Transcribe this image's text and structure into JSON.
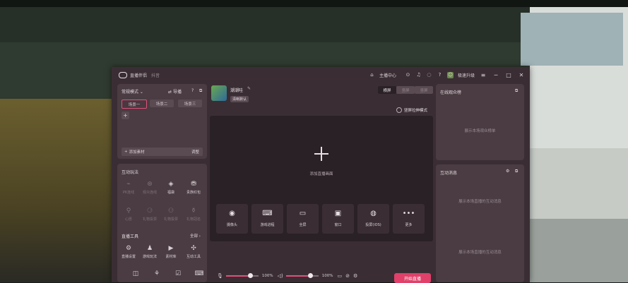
{
  "window": {
    "title": "直播伴侣",
    "subtitle": "抖音"
  },
  "titlebar": {
    "host_center": "主播中心",
    "upgrade": "极速升级",
    "min": "─",
    "max": "□",
    "close": "✕"
  },
  "scenes": {
    "mode_label": "常规模式",
    "guide_label": "导播",
    "items": [
      {
        "label": "场景一",
        "active": true
      },
      {
        "label": "场景二",
        "active": false
      },
      {
        "label": "场景三",
        "active": false
      }
    ],
    "add_icon": "+",
    "add_material": "添加素材",
    "adjust": "调整"
  },
  "interactive": {
    "title": "互动玩法",
    "items": [
      {
        "icon": "⌁",
        "label": "PK连线",
        "dim": true
      },
      {
        "icon": "⊛",
        "label": "观众连线",
        "dim": true
      },
      {
        "icon": "◈",
        "label": "福袋",
        "dim": false
      },
      {
        "icon": "⛃",
        "label": "贵族红包",
        "dim": false
      },
      {
        "icon": "⚲",
        "label": "心愿",
        "dim": true
      },
      {
        "icon": "⚆",
        "label": "礼物投票",
        "dim": true
      },
      {
        "icon": "⚇",
        "label": "礼物投票",
        "dim": true
      },
      {
        "icon": "⚱",
        "label": "礼物冠名",
        "dim": true
      }
    ]
  },
  "tools": {
    "title": "直播工具",
    "all": "全部 ›",
    "items": [
      {
        "icon": "⚙",
        "label": "直播设置"
      },
      {
        "icon": "♟",
        "label": "游戏玩法"
      },
      {
        "icon": "▶",
        "label": "素材库"
      },
      {
        "icon": "✣",
        "label": "互动工具"
      }
    ]
  },
  "stream": {
    "name": "潮潮哇",
    "tag": "清晰默认",
    "orientation": {
      "landscape": "横屏",
      "portrait": "竖屏",
      "both": "竖屏"
    },
    "stretch_mode": "竖屏拉伸模式",
    "add_scene_text": "添加直播画面",
    "sources": [
      {
        "icon": "◉",
        "label": "摄像头"
      },
      {
        "icon": "⌨",
        "label": "游戏进程"
      },
      {
        "icon": "▭",
        "label": "全屏"
      },
      {
        "icon": "▣",
        "label": "窗口"
      },
      {
        "icon": "",
        "label": "投屏(iOS)"
      },
      {
        "icon": "•••",
        "label": "更多"
      }
    ]
  },
  "audio": {
    "mic_percent": "100%",
    "speaker_percent": "100%",
    "mic_level": 0.75,
    "speaker_level": 0.75
  },
  "start_button": "开始直播",
  "viewers": {
    "title": "在线观众榜",
    "empty_hint": "展示本场观众榜单"
  },
  "messages": {
    "title": "互动消息",
    "hint_top": "展示本场直播的互动消息",
    "hint_bottom": "展示本场直播的互动消息"
  },
  "colors": {
    "accent": "#e0507a",
    "panel": "#4a3c42",
    "window": "#3a2e34"
  }
}
